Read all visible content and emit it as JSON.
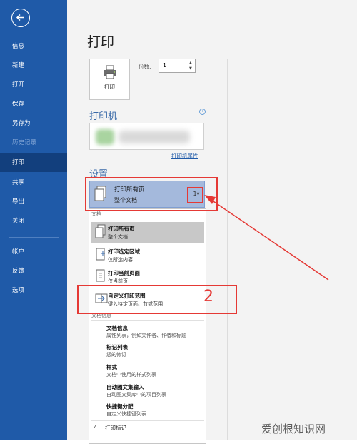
{
  "sidebar": {
    "items": [
      {
        "label": "信息"
      },
      {
        "label": "新建"
      },
      {
        "label": "打开"
      },
      {
        "label": "保存"
      },
      {
        "label": "另存为"
      },
      {
        "label": "历史记录"
      },
      {
        "label": "打印"
      },
      {
        "label": "共享"
      },
      {
        "label": "导出"
      },
      {
        "label": "关闭"
      },
      {
        "label": "帐户"
      },
      {
        "label": "反馈"
      },
      {
        "label": "选项"
      }
    ],
    "active": "打印",
    "disabled": "历史记录"
  },
  "print": {
    "title": "打印",
    "button_label": "打印",
    "copies_label": "份数:",
    "copies_value": "1"
  },
  "printer": {
    "heading": "打印机",
    "properties_link": "打印机属性"
  },
  "settings": {
    "heading": "设置",
    "selected_title": "打印所有页",
    "selected_subtitle": "整个文档",
    "selected_badge": "1"
  },
  "dropdown": {
    "group_document": "文档",
    "options": [
      {
        "title": "打印所有页",
        "desc": "整个文档"
      },
      {
        "title": "打印选定区域",
        "desc": "仅所选内容"
      },
      {
        "title": "打印当前页面",
        "desc": "仅当前页"
      },
      {
        "title": "自定义打印范围",
        "desc": "键入特定页面、节或范围"
      }
    ],
    "group_info": "文档信息",
    "info_items": [
      {
        "title": "文档信息",
        "desc": "属性列表，例如文件名、作者和标题"
      },
      {
        "title": "标记列表",
        "desc": "您的修订"
      },
      {
        "title": "样式",
        "desc": "文档中使用的样式列表"
      },
      {
        "title": "自动图文集输入",
        "desc": "自动图文集库中的项目列表"
      },
      {
        "title": "快捷键分配",
        "desc": "自定义快捷键列表"
      }
    ],
    "check_item": "打印标记"
  },
  "annotation": {
    "number": "2",
    "color": "#e53935"
  },
  "watermark": "爱创根知识网",
  "colors": {
    "sidebar": "#1f5aa8",
    "sidebar_active": "#123f7d",
    "accent": "#3a6aa8"
  }
}
